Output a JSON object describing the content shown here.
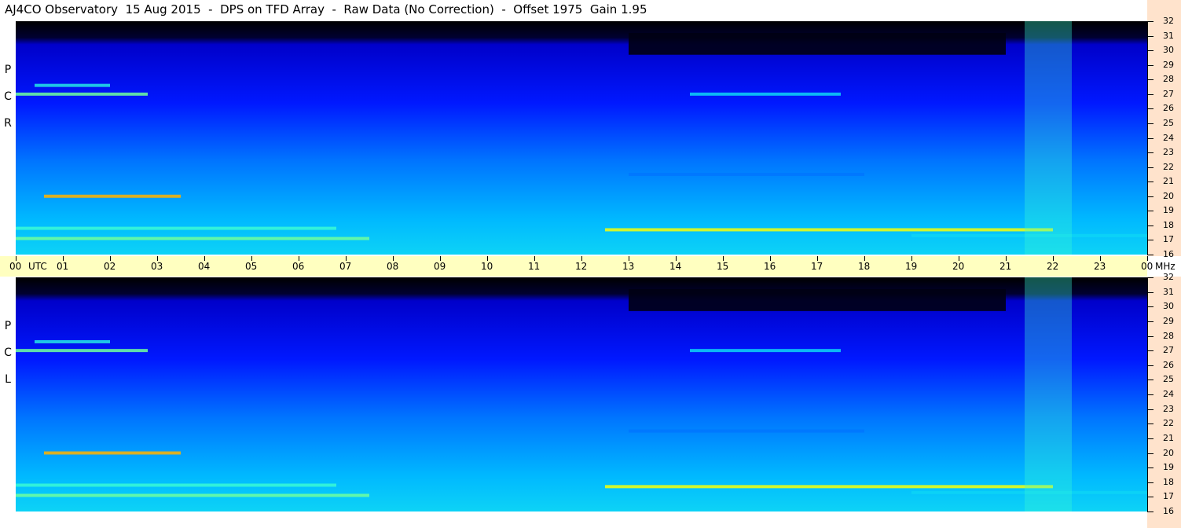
{
  "title": "AJ4CO Observatory  15 Aug 2015  -  DPS on TFD Array  -  Raw Data (No Correction)  -  Offset 1975  Gain 1.95",
  "panels": [
    {
      "label_letters": [
        "P",
        "C",
        "R"
      ]
    },
    {
      "label_letters": [
        "P",
        "C",
        "L"
      ]
    }
  ],
  "chart_data": {
    "type": "heatmap",
    "title": "AJ4CO Observatory  15 Aug 2015  -  DPS on TFD Array  -  Raw Data (No Correction)  -  Offset 1975  Gain 1.95",
    "x_ticks": [
      "00",
      "UTC",
      "01",
      "02",
      "03",
      "04",
      "05",
      "06",
      "07",
      "08",
      "09",
      "10",
      "11",
      "12",
      "13",
      "14",
      "15",
      "16",
      "17",
      "18",
      "19",
      "20",
      "21",
      "22",
      "23",
      "00"
    ],
    "x_unit_label": "UTC",
    "xlim": [
      0,
      24
    ],
    "y_ticks": [
      16,
      17,
      18,
      19,
      20,
      21,
      22,
      23,
      24,
      25,
      26,
      27,
      28,
      29,
      30,
      31,
      32
    ],
    "y_unit_label": "MHz",
    "ylim": [
      16,
      32
    ],
    "series": [
      {
        "name": "R C P"
      },
      {
        "name": "L C P"
      }
    ],
    "colormap": [
      "#000000",
      "#00008b",
      "#0000ff",
      "#0066ff",
      "#00c8ff",
      "#40ffd0",
      "#ffff00",
      "#ff0000"
    ],
    "features": [
      {
        "kind": "band",
        "freq": 27.0,
        "t_start": 0.0,
        "t_end": 2.8,
        "intensity": 0.75
      },
      {
        "kind": "band",
        "freq": 27.6,
        "t_start": 0.4,
        "t_end": 2.0,
        "intensity": 0.65
      },
      {
        "kind": "band",
        "freq": 27.0,
        "t_start": 14.3,
        "t_end": 17.5,
        "intensity": 0.6
      },
      {
        "kind": "band",
        "freq": 20.0,
        "t_start": 0.6,
        "t_end": 3.5,
        "intensity": 0.9
      },
      {
        "kind": "band",
        "freq": 17.8,
        "t_start": 0.0,
        "t_end": 6.8,
        "intensity": 0.7
      },
      {
        "kind": "band",
        "freq": 17.1,
        "t_start": 0.0,
        "t_end": 7.5,
        "intensity": 0.75
      },
      {
        "kind": "band",
        "freq": 17.7,
        "t_start": 12.5,
        "t_end": 22.0,
        "intensity": 0.85
      },
      {
        "kind": "band",
        "freq": 17.3,
        "t_start": 19.0,
        "t_end": 24.0,
        "intensity": 0.6
      },
      {
        "kind": "band",
        "freq": 21.5,
        "t_start": 13.0,
        "t_end": 18.0,
        "intensity": 0.45
      },
      {
        "kind": "burst",
        "t_start": 21.4,
        "t_end": 22.4,
        "intensity": 0.7
      }
    ]
  }
}
